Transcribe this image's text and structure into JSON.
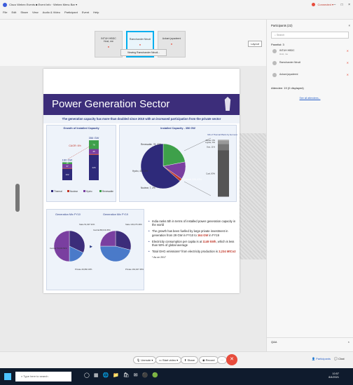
{
  "window": {
    "title": "Cisco Webex Events ■ Event Info · Webex Menu Bar ▾",
    "status": "Connected ▾",
    "controls": [
      "–",
      "□",
      "×"
    ]
  },
  "menu": [
    "File",
    "Edit",
    "Share",
    "View",
    "Audio & Video",
    "Participant",
    "Event",
    "Help"
  ],
  "video_tiles": [
    {
      "name": "INTUH HBDC",
      "sub": "Host, me"
    },
    {
      "name": "Ramchander Nirudi",
      "sub": ""
    },
    {
      "name": "Ackani jayadeeni",
      "sub": ""
    }
  ],
  "layout_label": "Layout",
  "viewing_tip": "Viewing Ramchander Nirudi...",
  "slide": {
    "title": "Power Generation Sector",
    "subtitle": "The generation capacity has more than doubled since 2010 with an increased participation from the private sector",
    "growth_panel": {
      "title": "Growth of Installed Capacity",
      "cagr": "CAGR: 6%",
      "bars": [
        {
          "label": "FY10",
          "total": "160 GW",
          "thermal": 102,
          "nuclear": 5,
          "hydro": 37,
          "renewable": 16
        },
        {
          "label": "FY19",
          "total": "356 GW",
          "thermal": 226,
          "nuclear": 7,
          "hydro": 45,
          "renewable": 78
        }
      ],
      "legend": [
        "Thermal",
        "Nuclear",
        "Hydro",
        "Renewable"
      ]
    },
    "capacity_panel": {
      "title": "Installed Capacity - 356 GW",
      "slices": [
        {
          "label": "Renewable, 78, 22%",
          "value": 78
        },
        {
          "label": "Hydro, 45, 13%",
          "value": 45
        },
        {
          "label": "Nuclear, 7, 2%",
          "value": 7
        },
        {
          "label": "Thermal, 226, 63%",
          "value": 226
        }
      ],
      "mix_title": "Mix of Thermal Plants by fuel source",
      "mix": [
        {
          "label": "Diesel, 0%",
          "value": 0.2
        },
        {
          "label": "Lignite, 6%",
          "value": 6
        },
        {
          "label": "Gas, 11%",
          "value": 11
        },
        {
          "label": "Coal, 83%",
          "value": 83
        }
      ]
    },
    "mix_panels": [
      {
        "title": "Generation Mix FY10",
        "slices": [
          {
            "label": "State 51,907 32%",
            "value": 32
          },
          {
            "label": "Private 29,682 18%",
            "value": 18
          },
          {
            "label": "Central 79,009 50%",
            "value": 50
          }
        ]
      },
      {
        "title": "Generation Mix FY19",
        "slices": [
          {
            "label": "State 103,276 29%",
            "value": 29
          },
          {
            "label": "Private 164,027 46%",
            "value": 46
          },
          {
            "label": "Central 88,019 25%",
            "value": 25
          }
        ],
        "arrow": "▶"
      }
    ],
    "bullets": [
      {
        "text": "India ranks 5th in terms of installed power generation capacity in the world"
      },
      {
        "text": "The growth has been fuelled by large private investment in generation from 29 GW in FY10 to ",
        "hl": "164 GW",
        "tail": " in FY19"
      },
      {
        "text": "Electricity consumption per capita is at ",
        "hl": "1149 kWh",
        "tail": ", which is less than 50% of global average"
      },
      {
        "text": "Total GHG emissions* from electricity production is ",
        "hl": "2,234 MtCo2",
        "tail": ""
      }
    ],
    "note": "* As on 2017"
  },
  "participants": {
    "header": "Participants (22)",
    "close": "×",
    "search_placeholder": "Search",
    "panelist_group": "Panelist: 3",
    "people": [
      {
        "name": "INTUH HBDC",
        "sub": "Host, me"
      },
      {
        "name": "Ramchander Nirudi",
        "sub": ""
      },
      {
        "name": "Ackani jayadeeni",
        "sub": ""
      }
    ],
    "attendee_group": "Attendee: 19 (0 displayed)",
    "see_all": "See all attendees..."
  },
  "qa": {
    "label": "Q&A",
    "close": "×"
  },
  "toolbar": {
    "unmute": "Unmute ▾",
    "start_video": "Start video ▾",
    "share": "Share",
    "record": "Record",
    "more": "···",
    "end": "✕",
    "participants": "Participants",
    "chat": "Chat"
  },
  "taskbar": {
    "search_placeholder": "Type here to search",
    "icons": [
      "◯",
      "▦",
      "🌐",
      "📁",
      "🛍",
      "✉",
      "⚫",
      "🟢"
    ],
    "time": "10:57",
    "date": "8/4/2021"
  },
  "colors": {
    "thermal": "#2e2a7a",
    "nuclear": "#c0392b",
    "hydro": "#7a3fa0",
    "renewable": "#3ea04a",
    "slide_header": "#3c2d7a",
    "accent": "#00aeef"
  }
}
